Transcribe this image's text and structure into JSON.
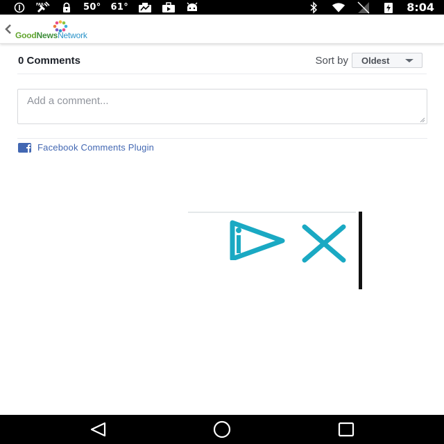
{
  "status_bar": {
    "temp_1": "50°",
    "temp_2": "61°",
    "clock": "8:04",
    "icons": [
      "info-icon",
      "satellite-icon",
      "lock-icon",
      "weather-icon",
      "briefcase-icon",
      "android-icon",
      "bluetooth-icon",
      "wifi-icon",
      "signal-icon",
      "battery-icon"
    ]
  },
  "header": {
    "logo_good": "Good",
    "logo_news": "News",
    "logo_network": "Network"
  },
  "comments": {
    "count_label": "0 Comments",
    "sort_label": "Sort by",
    "sort_value": "Oldest",
    "input_placeholder": "Add a comment...",
    "input_value": "",
    "plugin_label": "Facebook Comments Plugin"
  },
  "colors": {
    "facebook_blue": "#4267b2",
    "ad_cyan": "#1aa9c3",
    "logo_green": "#62a52e",
    "logo_blue": "#2a93c9"
  },
  "nav_bar": {
    "icons": [
      "back-triangle-icon",
      "home-circle-icon",
      "recents-square-icon"
    ]
  }
}
